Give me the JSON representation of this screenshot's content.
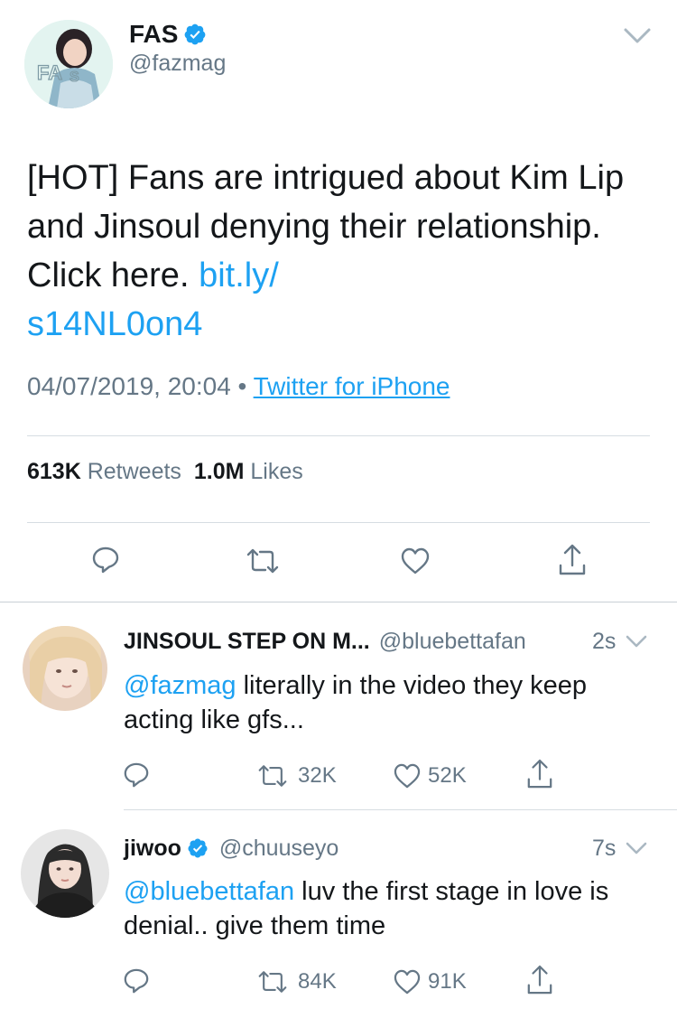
{
  "tweet": {
    "author_name": "FAS",
    "author_handle": "@fazmag",
    "text_before_link": "[HOT] Fans are intrigued about Kim Lip and Jinsoul denying their relationship. Click here. ",
    "link_line1": "bit.ly/",
    "link_line2": "s14NL0on4",
    "timestamp": "04/07/2019, 20:04",
    "separator": " • ",
    "source": "Twitter for iPhone",
    "retweets_count": "613K",
    "retweets_label": "Retweets",
    "likes_count": "1.0M",
    "likes_label": "Likes"
  },
  "replies": [
    {
      "author_name": "JINSOUL STEP ON M...",
      "author_handle": "@bluebettafan",
      "time": "2s",
      "mention": "@fazmag",
      "text": " literally in the video they keep acting like gfs...",
      "retweets": "32K",
      "likes": "52K"
    },
    {
      "author_name": "jiwoo",
      "author_handle": "@chuuseyo",
      "time": "7s",
      "mention": "@bluebettafan",
      "text": " luv the first stage in love is denial.. give them time",
      "retweets": "84K",
      "likes": "91K"
    }
  ],
  "colors": {
    "accent": "#1da1f2",
    "secondary_text": "#657786",
    "primary_text": "#14171a"
  },
  "icons": [
    "verified-badge-icon",
    "chevron-down-icon",
    "reply-icon",
    "retweet-icon",
    "like-icon",
    "share-icon"
  ]
}
